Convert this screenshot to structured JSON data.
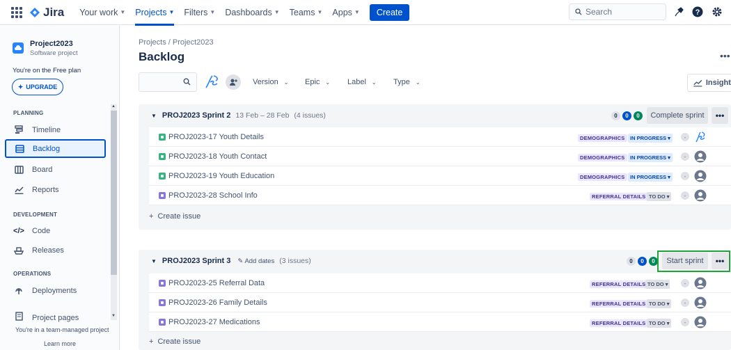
{
  "topnav": {
    "logo": "Jira",
    "items": [
      {
        "label": "Your work"
      },
      {
        "label": "Projects"
      },
      {
        "label": "Filters"
      },
      {
        "label": "Dashboards"
      },
      {
        "label": "Teams"
      },
      {
        "label": "Apps"
      }
    ],
    "active": "Projects",
    "create_label": "Create",
    "search_placeholder": "Search"
  },
  "sidebar": {
    "project_name": "Project2023",
    "project_type": "Software project",
    "plan_text": "You're on the Free plan",
    "upgrade_label": "UPGRADE",
    "sections": [
      {
        "heading": "PLANNING",
        "items": [
          "Timeline",
          "Backlog",
          "Board",
          "Reports"
        ]
      },
      {
        "heading": "DEVELOPMENT",
        "items": [
          "Code",
          "Releases"
        ]
      },
      {
        "heading": "OPERATIONS",
        "items": [
          "Deployments"
        ]
      }
    ],
    "project_pages": "Project pages",
    "footer_text": "You're in a team-managed project",
    "learn_more": "Learn more"
  },
  "main": {
    "breadcrumb": "Projects  /  Project2023",
    "title": "Backlog",
    "filters": [
      "Version",
      "Epic",
      "Label",
      "Type"
    ],
    "insights_label": "Insights"
  },
  "sprints": [
    {
      "name": "PROJ2023 Sprint 2",
      "dates": "13 Feb – 28 Feb",
      "issue_count": "(4 issues)",
      "counts": [
        "0",
        "0",
        "0"
      ],
      "action_label": "Complete sprint",
      "issues": [
        {
          "key_summary": "PROJ2023-17 Youth Details",
          "epic": "DEMOGRAPHICS",
          "status": "IN PROGRESS",
          "type": "story"
        },
        {
          "key_summary": "PROJ2023-18 Youth Contact",
          "epic": "DEMOGRAPHICS",
          "status": "IN PROGRESS",
          "type": "story"
        },
        {
          "key_summary": "PROJ2023-19 Youth Education",
          "epic": "DEMOGRAPHICS",
          "status": "IN PROGRESS",
          "type": "story"
        },
        {
          "key_summary": "PROJ2023-28 School Info",
          "epic": "REFERRAL DETAILS",
          "status": "TO DO",
          "type": "task"
        }
      ],
      "create_issue": "Create issue"
    },
    {
      "name": "PROJ2023 Sprint 3",
      "add_dates": "Add dates",
      "issue_count": "(3 issues)",
      "counts": [
        "0",
        "0",
        "0"
      ],
      "action_label": "Start sprint",
      "issues": [
        {
          "key_summary": "PROJ2023-25 Referral Data",
          "epic": "REFERRAL DETAILS",
          "status": "TO DO",
          "type": "task"
        },
        {
          "key_summary": "PROJ2023-26 Family Details",
          "epic": "REFERRAL DETAILS",
          "status": "TO DO",
          "type": "task"
        },
        {
          "key_summary": "PROJ2023-27 Medications",
          "epic": "REFERRAL DETAILS",
          "status": "TO DO",
          "type": "task"
        }
      ],
      "create_issue": "Create issue"
    }
  ],
  "colors": {
    "accent": "#0052CC",
    "highlight": "#22A33A",
    "story": "#36B37E",
    "task": "#8777D9"
  }
}
